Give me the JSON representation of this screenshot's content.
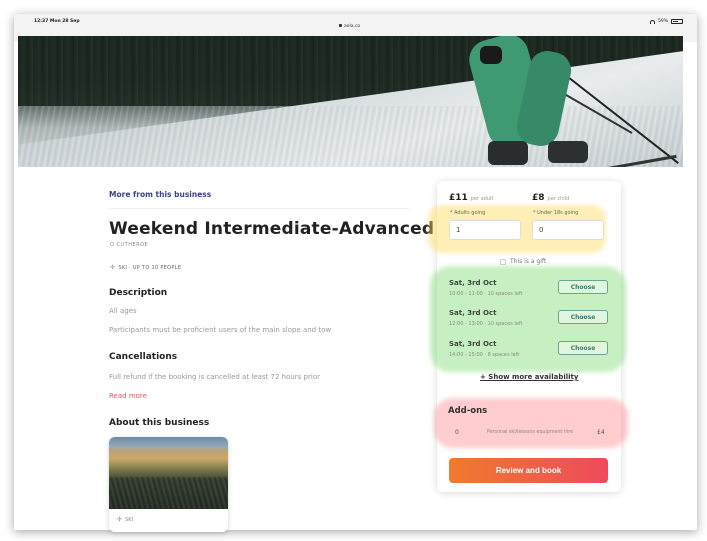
{
  "status_bar": {
    "time": "12:37  Mon 28 Sep",
    "url": "aola.co",
    "battery": "59%"
  },
  "activity": {
    "more_link": "More from this business",
    "title": "Weekend Intermediate-Advanced",
    "subtitle": "O CUTHEROE",
    "tags": "SKI · UP TO 10 PEOPLE",
    "description_heading": "Description",
    "description_lines": [
      "All ages",
      "Participants must be proficient users of the main slope and tow"
    ],
    "cancellations_heading": "Cancellations",
    "cancellations_text": "Full refund if the booking is cancelled at least 72 hours prior",
    "read_more": "Read more",
    "about_heading": "About this business",
    "business_tag": "SKI"
  },
  "booking": {
    "adult_price": "£11",
    "adult_unit": "per adult",
    "child_price": "£8",
    "child_unit": "per child",
    "adults_label": "* Adults going",
    "adults_value": "1",
    "under_label": "* Under 18s going",
    "under_value": "0",
    "gift_label": "This is a gift",
    "slots": [
      {
        "date": "Sat, 3rd Oct",
        "meta": "10:00 - 11:00 · 10 spaces left",
        "button": "Choose"
      },
      {
        "date": "Sat, 3rd Oct",
        "meta": "12:00 - 13:00 · 10 spaces left",
        "button": "Choose"
      },
      {
        "date": "Sat, 3rd Oct",
        "meta": "14:00 - 15:00 · 8 spaces left",
        "button": "Choose"
      }
    ],
    "show_more": "+ Show more availability",
    "addons_heading": "Add-ons",
    "addon": {
      "qty": "0",
      "name": "Personal ski/lessons equipment hire",
      "price": "£4"
    },
    "cta": "Review and book"
  },
  "colors": {
    "accent_link": "#3a3f8f",
    "read_more": "#e8546a",
    "cta_start": "#f07a2e",
    "cta_end": "#ee4a5c",
    "choose_border": "#6aa39a"
  }
}
